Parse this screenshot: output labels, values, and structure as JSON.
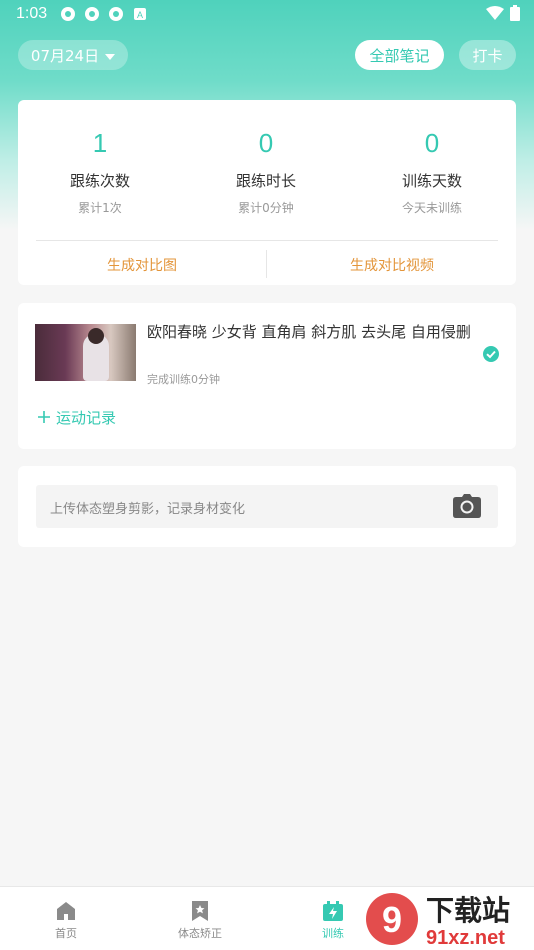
{
  "status_bar": {
    "time": "1:03"
  },
  "header": {
    "date": "07月24日",
    "notes_button": "全部笔记",
    "checkin_button": "打卡"
  },
  "stats": [
    {
      "value": "1",
      "label": "跟练次数",
      "sub": "累计1次"
    },
    {
      "value": "0",
      "label": "跟练时长",
      "sub": "累计0分钟"
    },
    {
      "value": "0",
      "label": "训练天数",
      "sub": "今天未训练"
    }
  ],
  "actions": {
    "compare_image": "生成对比图",
    "compare_video": "生成对比视频"
  },
  "video": {
    "title": "欧阳春晓  少女背 直角肩 斜方肌  去头尾  自用侵删",
    "sub": "完成训练0分钟",
    "add_record": "运动记录"
  },
  "upload": {
    "placeholder": "上传体态塑身剪影，记录身材变化"
  },
  "tabs": [
    {
      "label": "首页",
      "icon": "home-icon"
    },
    {
      "label": "体态矫正",
      "icon": "bookmark-icon"
    },
    {
      "label": "训练",
      "icon": "training-icon"
    }
  ],
  "watermark": {
    "text1": "下载站",
    "text2": "91xz.net"
  },
  "colors": {
    "accent": "#35c9b2",
    "orange": "#e3953a"
  }
}
